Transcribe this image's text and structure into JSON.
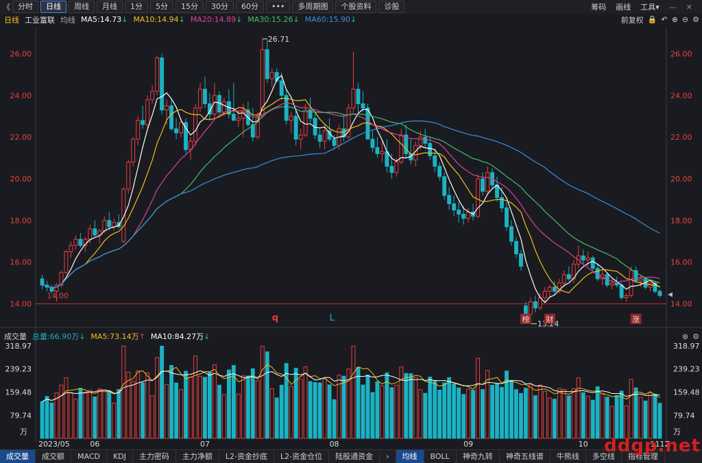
{
  "toolbar": {
    "back_icon": "《",
    "periods": [
      "分时",
      "日线",
      "周线",
      "月线",
      "1分",
      "5分",
      "15分",
      "30分",
      "60分",
      "•••",
      "多周期图",
      "个股资料",
      "诊股"
    ],
    "active": "日线",
    "right": [
      "筹码",
      "画线",
      "工具▾"
    ],
    "window_icons": [
      "minimize-icon",
      "close-icon"
    ]
  },
  "info": {
    "period": "日线",
    "stock_name": "工业富联",
    "avg_label": "均线",
    "ma5": "MA5:14.73",
    "ma10": "MA10:14.94",
    "ma20": "MA20:14.89",
    "ma30": "MA30:15.26",
    "ma60": "MA60:15.90",
    "arrow_down": "↓",
    "fq": "前复权"
  },
  "price_axis": {
    "labels": [
      "26.00",
      "24.00",
      "22.00",
      "20.00",
      "18.00",
      "16.00",
      "14.00"
    ],
    "min": 13.0,
    "max": 27.0
  },
  "annotations": {
    "high": "26.71",
    "low": "13.24",
    "left_low": "14.00",
    "q_mark": "q",
    "l_mark": "L",
    "badges": [
      "榜",
      "财",
      "涨"
    ]
  },
  "volume": {
    "title": "成交量",
    "total": "总量:66.90万",
    "ma5": "MA5:73.14万",
    "ma10": "MA10:84.27万",
    "arrow_up": "↑",
    "arrow_down": "↓",
    "axis_labels": [
      "318.97",
      "239.23",
      "159.48",
      "79.74"
    ],
    "unit": "万"
  },
  "date_axis": [
    "2023/05",
    "06",
    "07",
    "08",
    "09",
    "10",
    "11",
    "12",
    "1"
  ],
  "bottom_tabs": [
    "成交量",
    "成交额",
    "MACD",
    "KDJ",
    "主力密码",
    "主力净额",
    "L2-资金抄底",
    "L2-资金仓位",
    "陆股通资金",
    "›",
    "均线",
    "BOLL",
    "神奇九转",
    "神奇五线谱",
    "牛熊线",
    "多空线",
    "指标管理"
  ],
  "watermark": "ddgp.net",
  "colors": {
    "up": "#e84040",
    "down": "#1ab3c4",
    "ma5": "#ffffff",
    "ma10": "#f2c01e",
    "ma20": "#e0409a",
    "ma30": "#3fc06a",
    "ma60": "#3a8fe0"
  },
  "chart_data": {
    "type": "candlestick",
    "candles": [
      [
        15.2,
        15.4,
        14.7,
        14.9
      ],
      [
        14.9,
        15.1,
        14.6,
        14.8
      ],
      [
        14.8,
        14.9,
        14.5,
        14.6
      ],
      [
        14.6,
        15.0,
        14.1,
        14.9
      ],
      [
        14.9,
        15.6,
        14.8,
        15.5
      ],
      [
        15.5,
        16.6,
        15.4,
        16.5
      ],
      [
        16.5,
        17.0,
        16.2,
        16.8
      ],
      [
        16.8,
        17.3,
        16.6,
        17.1
      ],
      [
        17.1,
        17.4,
        16.7,
        16.8
      ],
      [
        16.8,
        17.2,
        16.5,
        17.1
      ],
      [
        17.1,
        17.8,
        16.9,
        17.6
      ],
      [
        17.6,
        18.0,
        17.2,
        17.3
      ],
      [
        17.3,
        17.6,
        16.9,
        17.5
      ],
      [
        17.5,
        18.2,
        17.4,
        18.0
      ],
      [
        18.0,
        18.4,
        17.5,
        17.7
      ],
      [
        17.7,
        18.1,
        17.5,
        17.9
      ],
      [
        17.9,
        18.3,
        17.6,
        17.7
      ],
      [
        17.0,
        19.6,
        16.9,
        19.5
      ],
      [
        19.5,
        20.9,
        19.3,
        20.8
      ],
      [
        20.8,
        22.0,
        20.6,
        21.9
      ],
      [
        21.9,
        23.0,
        21.6,
        22.8
      ],
      [
        22.8,
        23.5,
        22.4,
        22.6
      ],
      [
        22.6,
        24.0,
        22.4,
        23.8
      ],
      [
        23.8,
        24.5,
        23.6,
        24.2
      ],
      [
        24.2,
        25.9,
        24.0,
        25.8
      ],
      [
        25.8,
        26.0,
        23.1,
        23.3
      ],
      [
        23.3,
        23.8,
        22.6,
        23.5
      ],
      [
        23.5,
        23.8,
        22.3,
        22.4
      ],
      [
        22.4,
        22.9,
        21.9,
        22.2
      ],
      [
        22.2,
        22.9,
        22.0,
        22.7
      ],
      [
        22.7,
        22.9,
        21.2,
        21.4
      ],
      [
        21.4,
        22.0,
        20.9,
        21.8
      ],
      [
        21.8,
        23.6,
        21.6,
        23.4
      ],
      [
        23.4,
        24.6,
        23.2,
        24.3
      ],
      [
        24.3,
        24.9,
        23.4,
        23.6
      ],
      [
        23.6,
        24.1,
        22.8,
        23.1
      ],
      [
        23.1,
        24.6,
        22.9,
        24.0
      ],
      [
        24.0,
        24.2,
        23.1,
        23.2
      ],
      [
        23.2,
        23.9,
        23.0,
        23.7
      ],
      [
        23.7,
        24.3,
        22.9,
        23.1
      ],
      [
        23.1,
        24.6,
        22.9,
        22.8
      ],
      [
        22.8,
        23.3,
        22.5,
        22.9
      ],
      [
        22.9,
        23.6,
        22.0,
        23.3
      ],
      [
        23.3,
        23.7,
        22.5,
        22.6
      ],
      [
        22.6,
        23.4,
        21.8,
        22.0
      ],
      [
        22.0,
        23.2,
        21.9,
        23.0
      ],
      [
        23.0,
        26.7,
        22.9,
        26.2
      ],
      [
        26.2,
        26.7,
        24.6,
        24.8
      ],
      [
        24.8,
        25.3,
        24.4,
        25.1
      ],
      [
        25.1,
        25.3,
        24.6,
        24.7
      ],
      [
        24.7,
        25.1,
        23.8,
        24.0
      ],
      [
        24.0,
        24.3,
        22.6,
        22.8
      ],
      [
        22.8,
        23.2,
        22.2,
        23.0
      ],
      [
        23.0,
        23.4,
        21.6,
        21.9
      ],
      [
        21.9,
        22.4,
        21.4,
        22.1
      ],
      [
        22.1,
        23.6,
        22.0,
        23.3
      ],
      [
        23.3,
        23.9,
        22.7,
        22.9
      ],
      [
        22.9,
        23.2,
        21.9,
        22.1
      ],
      [
        22.1,
        22.4,
        21.5,
        21.8
      ],
      [
        21.8,
        22.6,
        21.4,
        22.3
      ],
      [
        22.3,
        22.9,
        21.8,
        21.9
      ],
      [
        21.9,
        22.1,
        21.4,
        21.6
      ],
      [
        21.6,
        22.6,
        21.4,
        22.4
      ],
      [
        22.4,
        23.1,
        21.8,
        22.0
      ],
      [
        22.0,
        23.6,
        21.9,
        23.4
      ],
      [
        23.4,
        26.1,
        23.2,
        24.3
      ],
      [
        24.3,
        24.6,
        23.1,
        23.6
      ],
      [
        23.6,
        24.2,
        23.2,
        23.4
      ],
      [
        23.4,
        23.6,
        22.1,
        21.9
      ],
      [
        21.9,
        22.3,
        21.3,
        21.5
      ],
      [
        21.5,
        22.0,
        21.0,
        21.2
      ],
      [
        21.2,
        21.8,
        20.8,
        21.3
      ],
      [
        21.3,
        21.9,
        20.3,
        20.6
      ],
      [
        20.6,
        21.2,
        20.0,
        20.3
      ],
      [
        20.3,
        21.0,
        20.1,
        20.8
      ],
      [
        20.8,
        22.4,
        20.7,
        22.1
      ],
      [
        22.1,
        22.6,
        21.0,
        21.2
      ],
      [
        21.2,
        21.9,
        20.7,
        20.9
      ],
      [
        20.9,
        21.8,
        20.6,
        21.6
      ],
      [
        21.6,
        22.3,
        21.4,
        22.0
      ],
      [
        22.0,
        22.4,
        21.5,
        21.7
      ],
      [
        21.7,
        22.0,
        20.9,
        21.1
      ],
      [
        21.1,
        21.4,
        20.3,
        20.6
      ],
      [
        20.6,
        20.8,
        19.9,
        20.1
      ],
      [
        20.1,
        20.3,
        19.0,
        19.2
      ],
      [
        19.2,
        19.6,
        18.5,
        18.8
      ],
      [
        18.8,
        19.2,
        18.2,
        18.5
      ],
      [
        18.5,
        18.9,
        17.9,
        18.3
      ],
      [
        18.3,
        18.7,
        17.8,
        18.1
      ],
      [
        18.1,
        18.6,
        17.9,
        18.4
      ],
      [
        18.4,
        18.8,
        18.0,
        18.2
      ],
      [
        18.2,
        20.2,
        18.1,
        20.0
      ],
      [
        20.0,
        20.3,
        19.2,
        19.4
      ],
      [
        19.4,
        20.6,
        19.2,
        20.3
      ],
      [
        20.3,
        20.5,
        19.5,
        19.7
      ],
      [
        19.7,
        20.1,
        18.9,
        19.1
      ],
      [
        19.1,
        19.6,
        18.4,
        18.6
      ],
      [
        18.6,
        18.9,
        17.5,
        17.7
      ],
      [
        17.7,
        18.0,
        16.8,
        17.0
      ],
      [
        17.0,
        17.2,
        16.2,
        16.4
      ],
      [
        16.4,
        16.6,
        15.6,
        15.8
      ],
      [
        13.9,
        14.1,
        13.3,
        13.5
      ],
      [
        13.5,
        14.3,
        13.24,
        14.1
      ],
      [
        14.1,
        14.4,
        13.6,
        13.8
      ],
      [
        13.8,
        14.5,
        13.7,
        14.3
      ],
      [
        14.3,
        14.8,
        14.1,
        14.6
      ],
      [
        14.6,
        14.9,
        14.3,
        14.8
      ],
      [
        14.8,
        15.1,
        14.4,
        14.6
      ],
      [
        14.6,
        15.2,
        14.5,
        15.0
      ],
      [
        15.0,
        15.6,
        14.8,
        15.4
      ],
      [
        15.4,
        15.8,
        15.1,
        15.2
      ],
      [
        15.2,
        16.1,
        15.0,
        15.9
      ],
      [
        15.9,
        16.8,
        15.7,
        16.3
      ],
      [
        16.3,
        16.6,
        15.9,
        16.1
      ],
      [
        16.1,
        16.5,
        15.8,
        16.2
      ],
      [
        16.2,
        16.3,
        15.6,
        15.7
      ],
      [
        15.7,
        15.9,
        15.1,
        15.2
      ],
      [
        15.2,
        15.6,
        14.9,
        15.4
      ],
      [
        15.4,
        15.5,
        14.8,
        14.9
      ],
      [
        14.9,
        15.2,
        14.7,
        15.0
      ],
      [
        15.0,
        15.3,
        14.8,
        14.9
      ],
      [
        14.9,
        15.0,
        14.2,
        14.3
      ],
      [
        14.3,
        14.5,
        14.1,
        14.4
      ],
      [
        14.4,
        15.8,
        14.3,
        15.6
      ],
      [
        15.6,
        15.8,
        15.0,
        15.1
      ],
      [
        15.1,
        15.4,
        14.8,
        15.2
      ],
      [
        15.2,
        15.3,
        14.7,
        14.8
      ],
      [
        14.8,
        15.1,
        14.6,
        15.0
      ],
      [
        15.0,
        15.1,
        14.5,
        14.6
      ],
      [
        14.6,
        14.7,
        14.3,
        14.4
      ]
    ]
  }
}
